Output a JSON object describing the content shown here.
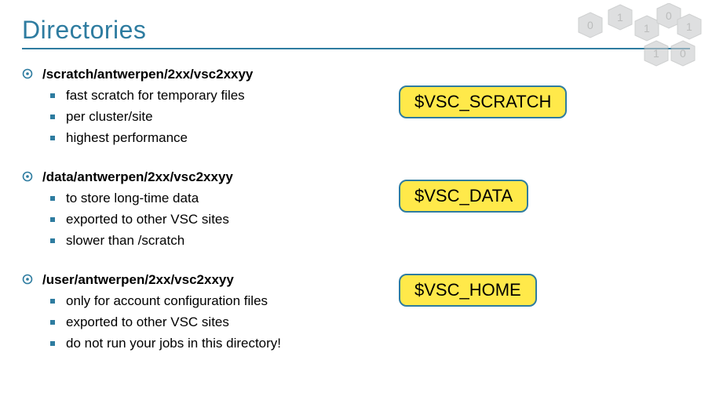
{
  "title": "Directories",
  "sections": [
    {
      "heading": "/scratch/antwerpen/2xx/vsc2xxyy",
      "items": [
        "fast scratch for temporary files",
        "per cluster/site",
        "highest performance"
      ],
      "badge": "$VSC_SCRATCH"
    },
    {
      "heading": "/data/antwerpen/2xx/vsc2xxyy",
      "items": [
        "to store long-time data",
        "exported to other VSC sites",
        "slower than /scratch"
      ],
      "badge": "$VSC_DATA"
    },
    {
      "heading": "/user/antwerpen/2xx/vsc2xxyy",
      "items": [
        "only for account configuration files",
        "exported to other VSC sites",
        "do not run your jobs in this directory!"
      ],
      "badge": "$VSC_HOME"
    }
  ]
}
